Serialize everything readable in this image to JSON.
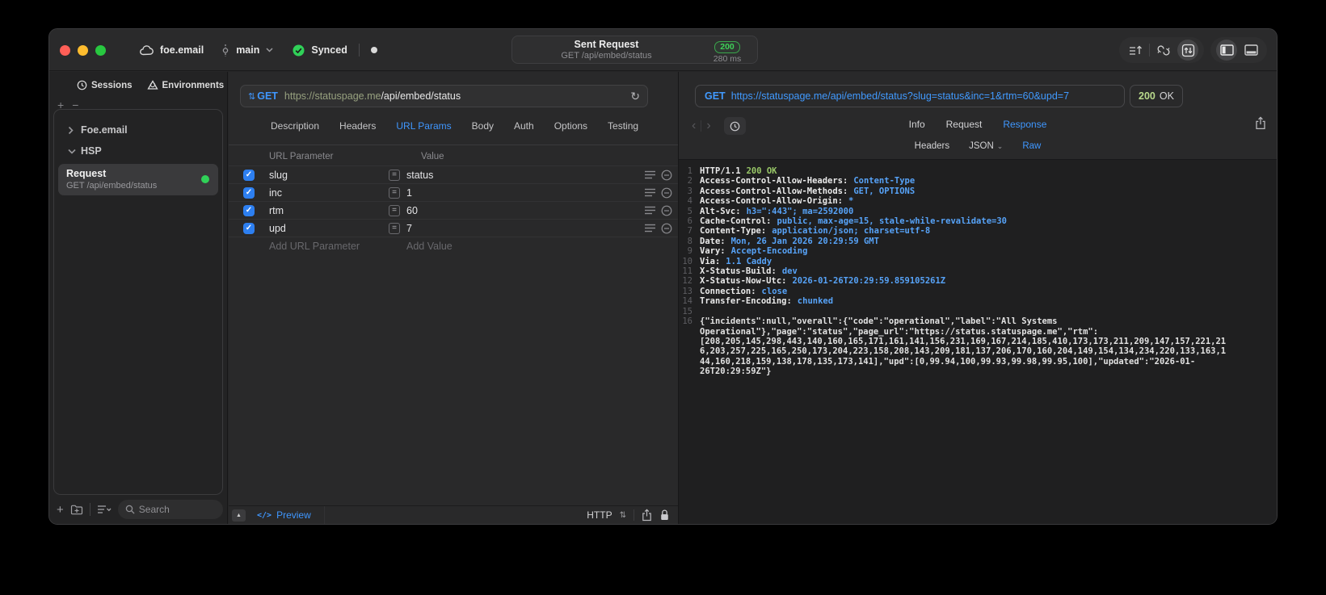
{
  "colors": {
    "accent_blue": "#3f97ff",
    "green": "#30d158",
    "code_value_blue": "#57a3f8",
    "code_green": "#98c767",
    "checkbox_blue": "#2d7ff0",
    "host_green": "#97a17f"
  },
  "titlebar": {
    "project": "foe.email",
    "branch": "main",
    "sync_label": "Synced",
    "request_summary": {
      "title": "Sent Request",
      "subtitle": "GET /api/embed/status",
      "status_code": "200",
      "duration": "280 ms"
    }
  },
  "sidebar": {
    "tabs": [
      {
        "label": "Sessions"
      },
      {
        "label": "Environments"
      }
    ],
    "tree": [
      {
        "label": "Foe.email"
      },
      {
        "label": "HSP"
      }
    ],
    "request_item": {
      "title": "Request",
      "subtitle": "GET /api/embed/status"
    },
    "search_placeholder": "Search"
  },
  "request_pane": {
    "method": "GET",
    "url_host": "https://statuspage.me",
    "url_path": "/api/embed/status",
    "tabs": [
      "Description",
      "Headers",
      "URL Params",
      "Body",
      "Auth",
      "Options",
      "Testing"
    ],
    "active_tab": "URL Params",
    "table": {
      "col_param": "URL Parameter",
      "col_value": "Value",
      "equals_sign": "=",
      "rows": [
        {
          "name": "slug",
          "value": "status"
        },
        {
          "name": "inc",
          "value": "1"
        },
        {
          "name": "rtm",
          "value": "60"
        },
        {
          "name": "upd",
          "value": "7"
        }
      ],
      "add_param_placeholder": "Add URL Parameter",
      "add_value_placeholder": "Add Value"
    },
    "footer": {
      "preview_label": "Preview",
      "code_glyph": "</>",
      "protocol": "HTTP"
    }
  },
  "response_pane": {
    "method": "GET",
    "url": "https://statuspage.me/api/embed/status?slug=status&inc=1&rtm=60&upd=7",
    "status_code": "200",
    "status_text": "OK",
    "tabs": [
      "Info",
      "Request",
      "Response"
    ],
    "active_tab": "Response",
    "subtabs": [
      "Headers",
      "JSON",
      "Raw"
    ],
    "active_subtab": "Raw",
    "raw_view": {
      "status_line": {
        "num": "1",
        "protocol": "HTTP/1.1",
        "status": "200 OK"
      },
      "headers": [
        {
          "num": "2",
          "name": "Access-Control-Allow-Headers:",
          "value": "Content-Type"
        },
        {
          "num": "3",
          "name": "Access-Control-Allow-Methods:",
          "value": "GET, OPTIONS"
        },
        {
          "num": "4",
          "name": "Access-Control-Allow-Origin:",
          "value": "*"
        },
        {
          "num": "5",
          "name": "Alt-Svc:",
          "value": "h3=\":443\"; ma=2592000"
        },
        {
          "num": "6",
          "name": "Cache-Control:",
          "value": "public, max-age=15, stale-while-revalidate=30"
        },
        {
          "num": "7",
          "name": "Content-Type:",
          "value": "application/json; charset=utf-8"
        },
        {
          "num": "8",
          "name": "Date:",
          "value": "Mon, 26 Jan 2026 20:29:59 GMT"
        },
        {
          "num": "9",
          "name": "Vary:",
          "value": "Accept-Encoding"
        },
        {
          "num": "10",
          "name": "Via:",
          "value": "1.1 Caddy"
        },
        {
          "num": "11",
          "name": "X-Status-Build:",
          "value": "dev"
        },
        {
          "num": "12",
          "name": "X-Status-Now-Utc:",
          "value": "2026-01-26T20:29:59.859105261Z"
        },
        {
          "num": "13",
          "name": "Connection:",
          "value": "close"
        },
        {
          "num": "14",
          "name": "Transfer-Encoding:",
          "value": "chunked"
        }
      ],
      "blank_line_num": "15",
      "body_line_num": "16",
      "body": "{\"incidents\":null,\"overall\":{\"code\":\"operational\",\"label\":\"All Systems Operational\"},\"page\":\"status\",\"page_url\":\"https://status.statuspage.me\",\"rtm\":[208,205,145,298,443,140,160,165,171,161,141,156,231,169,167,214,185,410,173,173,211,209,147,157,221,216,203,257,225,165,250,173,204,223,158,208,143,209,181,137,206,170,160,204,149,154,134,234,220,133,163,144,160,218,159,138,178,135,173,141],\"upd\":[0,99.94,100,99.93,99.98,99.95,100],\"updated\":\"2026-01-26T20:29:59Z\"}"
    }
  }
}
